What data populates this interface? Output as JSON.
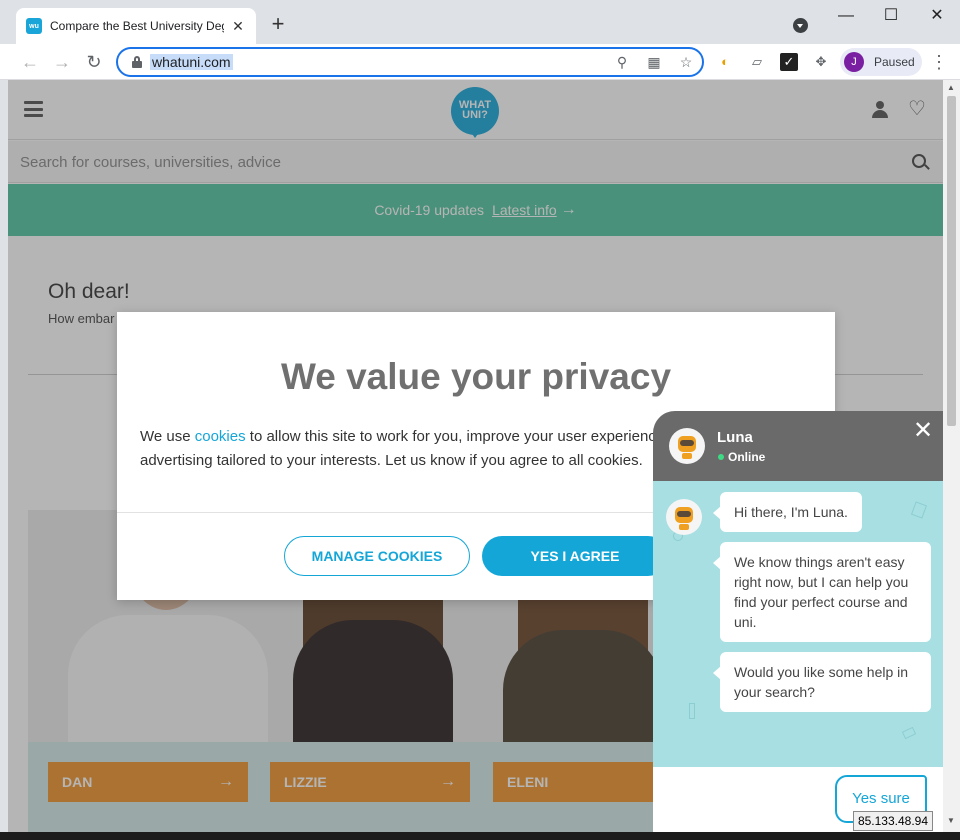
{
  "browser": {
    "tab_title": "Compare the Best University Deg",
    "tab_favicon_text": "wu",
    "url": "whatuni.com",
    "profile_initial": "J",
    "profile_status": "Paused",
    "new_tab_label": "+",
    "tab_close_label": "✕",
    "window_controls": {
      "minimize": "—",
      "maximize": "☐",
      "close": "✕"
    },
    "nav": {
      "back": "←",
      "forward": "→",
      "reload": "↻"
    },
    "omnibox_icons": [
      "location-icon",
      "qr-icon",
      "star-icon"
    ],
    "extension_icons": [
      "extension-a-icon",
      "extension-b-icon",
      "extension-c-icon",
      "puzzle-icon"
    ]
  },
  "site": {
    "logo_line1": "WHAT",
    "logo_line2": "UNI?",
    "search_placeholder": "Search for courses, universities, advice",
    "covid_text": "Covid-19 updates",
    "covid_link": "Latest info",
    "heading": "Oh dear!",
    "subtext": "How embar",
    "people": [
      {
        "name": "DAN"
      },
      {
        "name": "LIZZIE"
      },
      {
        "name": "ELENI"
      }
    ],
    "colors": {
      "brand": "#15a6d8",
      "covid_green": "#52c6a0",
      "name_card": "#f0932b"
    }
  },
  "cookie_modal": {
    "title": "We value your privacy",
    "text_before": "We use ",
    "link": "cookies",
    "text_after": " to allow this site to work for you, improve your user experience and show you advertising tailored to your interests. Let us know if you agree to all cookies.",
    "manage_button": "MANAGE COOKIES",
    "agree_button": "YES I AGREE"
  },
  "chat": {
    "bot_name": "Luna",
    "status": "Online",
    "close_label": "✕",
    "messages": [
      "Hi there, I'm Luna.",
      "We know things aren't easy right now, but I can help you find your perfect course and uni.",
      "Would you like some help in your search?"
    ],
    "reply": "Yes sure"
  },
  "tooltip": {
    "ip": "85.133.48.94"
  }
}
